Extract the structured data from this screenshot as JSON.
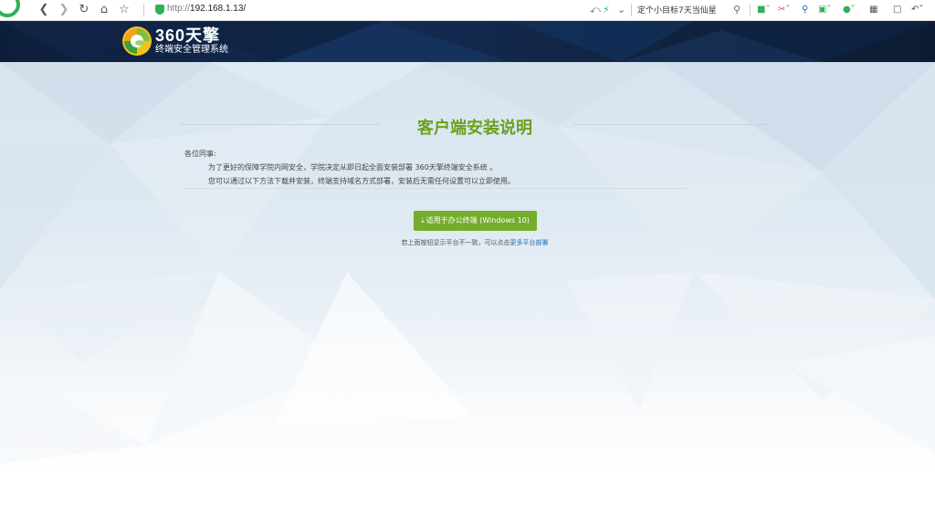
{
  "browser": {
    "url_scheme": "http://",
    "url_host": "192.168.1.13/",
    "search_text": "定个小目标7天当仙星",
    "back_icon": "chevron-left-icon",
    "forward_icon": "chevron-right-icon",
    "refresh_icon": "refresh-icon",
    "home_icon": "home-icon",
    "favorite_icon": "star-icon",
    "accent_color": "#2fb05a"
  },
  "header": {
    "logo_title": "360天擎",
    "logo_subtitle": "终端安全管理系统",
    "bg_color": "#10233f"
  },
  "main": {
    "title": "客户端安装说明",
    "greeting": "各位同事:",
    "paragraph_1": "为了更好的保障学院内网安全，学院决定从即日起全面安装部署 360天擎终端安全系统 。",
    "paragraph_2": "您可以通过以下方法下载并安装，终端支持域名方式部署，安装后无需任何设置可以立即使用。",
    "download_button": "适用于办公终端 (Windows 10)",
    "download_icon": "download-icon",
    "hint_text": "若上面按钮显示平台不一致，可以点击",
    "hint_link": "更多平台部署",
    "title_color": "#6aa21a",
    "button_color": "#74ad2c",
    "link_color": "#2a6fb8"
  }
}
